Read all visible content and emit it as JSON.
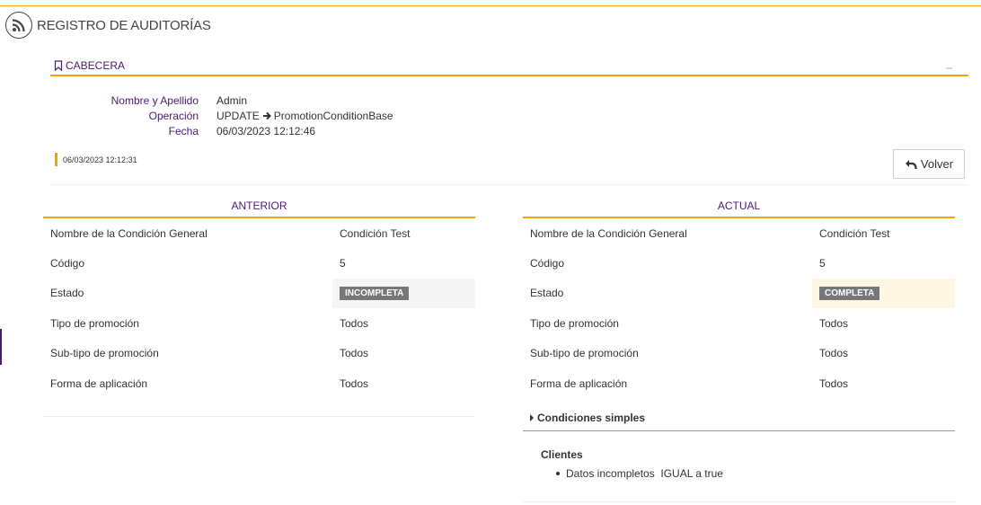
{
  "header": {
    "title": "REGISTRO DE AUDITORÍAS",
    "icon": "rss-icon"
  },
  "section": {
    "title": "CABECERA",
    "collapse_symbol": "–"
  },
  "info": [
    {
      "label": "Nombre y Apellido",
      "value": "Admin"
    },
    {
      "label": "Operación",
      "value_op": "UPDATE",
      "value_target": "PromotionConditionBase"
    },
    {
      "label": "Fecha",
      "value": "06/03/2023 12:12:46"
    }
  ],
  "timestamp": "06/03/2023 12:12:31",
  "volver_label": "Volver",
  "anterior": {
    "title": "ANTERIOR",
    "rows": [
      {
        "key": "Nombre de la Condición General",
        "value": "Condición Test"
      },
      {
        "key": "Código",
        "value": "5"
      },
      {
        "key": "Estado",
        "value": "INCOMPLETA"
      },
      {
        "key": "Tipo de promoción",
        "value": "Todos"
      },
      {
        "key": "Sub-tipo de promoción",
        "value": "Todos"
      },
      {
        "key": "Forma de aplicación",
        "value": "Todos"
      }
    ]
  },
  "actual": {
    "title": "ACTUAL",
    "rows": [
      {
        "key": "Nombre de la Condición General",
        "value": "Condición Test"
      },
      {
        "key": "Código",
        "value": "5"
      },
      {
        "key": "Estado",
        "value": "COMPLETA"
      },
      {
        "key": "Tipo de promoción",
        "value": "Todos"
      },
      {
        "key": "Sub-tipo de promoción",
        "value": "Todos"
      },
      {
        "key": "Forma de aplicación",
        "value": "Todos"
      }
    ]
  },
  "simples": {
    "title": "Condiciones simples",
    "group": "Clientes",
    "items": [
      "Datos incompletos  IGUAL a true"
    ]
  },
  "colors": {
    "accent": "#f0a500",
    "brand": "#4b1a6e",
    "badge": "#777777",
    "changed_bg": "#fcf6e2"
  }
}
